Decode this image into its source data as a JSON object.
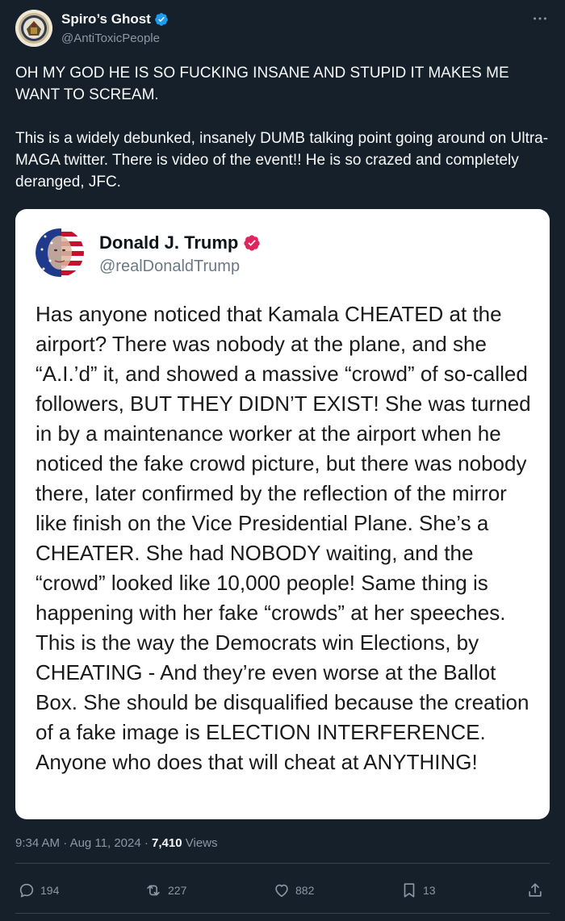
{
  "author": {
    "display_name": "Spiro’s Ghost",
    "handle": "@AntiToxicPeople",
    "verified_icon": "verified-badge-icon",
    "more_icon": "more-icon"
  },
  "tweet": {
    "paragraphs": [
      "OH MY GOD HE IS SO FUCKING INSANE AND STUPID IT MAKES ME WANT TO SCREAM.",
      "This is a widely debunked, insanely DUMB talking point going around on Ultra-MAGA twitter. There is video of the event!! He is so crazed and completely deranged, JFC."
    ]
  },
  "embedded_post": {
    "display_name": "Donald J. Trump",
    "handle": "@realDonaldTrump",
    "verified_icon": "verified-badge-icon",
    "text": "Has anyone noticed that Kamala CHEATED at the airport? There was nobody at the plane, and she “A.I.’d” it, and showed a massive “crowd” of so-called followers, BUT THEY DIDN’T EXIST! She was turned in by a maintenance worker at the airport when he noticed the fake crowd picture, but there was nobody there, later confirmed by the reflection of the mirror like finish on the Vice Presidential Plane. She’s a CHEATER. She had NOBODY waiting, and the “crowd” looked like 10,000 people! Same thing is happening with her fake “crowds” at her speeches. This is the way the Democrats win Elections, by CHEATING - And they’re even worse at the Ballot Box. She should be disqualified because the creation of a fake image is ELECTION INTERFERENCE. Anyone who does that will cheat at ANYTHING!"
  },
  "meta": {
    "time": "9:34 AM",
    "separator": "·",
    "date": "Aug 11, 2024",
    "views_count": "7,410",
    "views_label": "Views"
  },
  "actions": {
    "replies": "194",
    "reposts": "227",
    "likes": "882",
    "bookmarks": "13"
  },
  "colors": {
    "background": "#15202b",
    "primary_text": "#f7f9f9",
    "secondary_text": "#8b98a5",
    "verified_blue": "#1d9bf0",
    "verified_gold": "#e0245e",
    "divider": "#38444d"
  }
}
